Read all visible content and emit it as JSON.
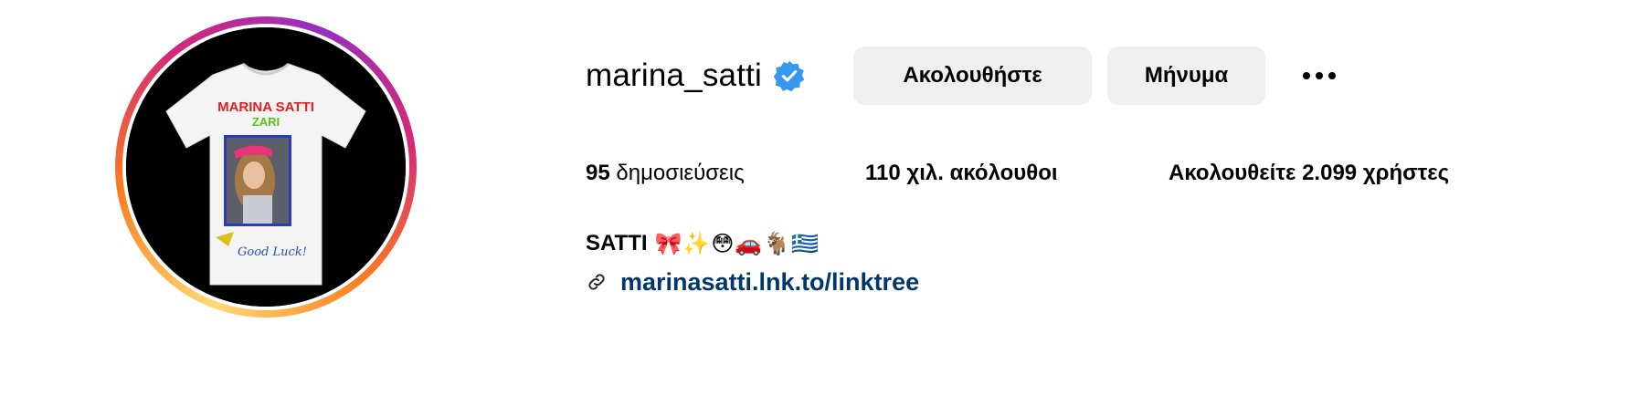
{
  "profile": {
    "username": "marina_satti",
    "verified": true,
    "avatar_alt": "profile-picture",
    "accent_color": "#3897f0"
  },
  "actions": {
    "follow_label": "Ακολουθήστε",
    "message_label": "Μήνυμα",
    "more_icon": "more-horizontal-icon"
  },
  "stats": {
    "posts_count": "95",
    "posts_label": "δημοσιεύσεις",
    "followers_count": "110 χιλ.",
    "followers_label": "ακόλουθοι",
    "following_prefix": "Ακολουθείτε",
    "following_count": "2.099",
    "following_suffix": "χρήστες"
  },
  "bio": {
    "name": "SATTI",
    "emojis": "🎀✨😳🚗🐐🇬🇷",
    "link_icon": "link-icon",
    "link_text": "marinasatti.lnk.to/linktree",
    "link_color": "#00376b"
  },
  "avatar_art": {
    "shirt_title": "MARINA SATTI",
    "shirt_subtitle": "ZARI",
    "shirt_caption": "Good Luck!"
  }
}
